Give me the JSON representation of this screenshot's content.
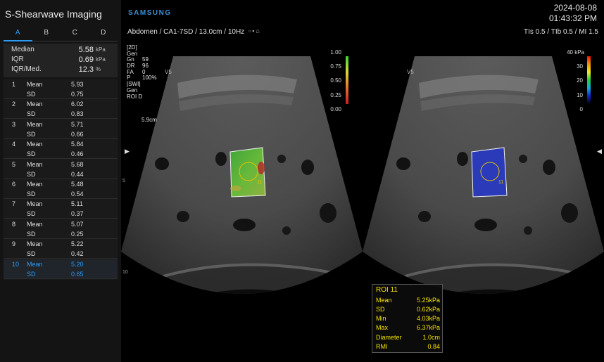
{
  "app": {
    "title": "S-Shearwave Imaging",
    "brand": "SAMSUNG",
    "date": "2024-08-08",
    "time": "01:43:32 PM"
  },
  "header": {
    "probe_line": "Abdomen / CA1-7SD / 13.0cm / 10Hz",
    "indices": "TIs  0.5 / TIb  0.5 / MI    1.5"
  },
  "tabs": [
    "A",
    "B",
    "C",
    "D"
  ],
  "active_tab": "A",
  "summary": {
    "median_label": "Median",
    "median_value": "5.58",
    "median_unit": "kPa",
    "iqr_label": "IQR",
    "iqr_value": "0.69",
    "iqr_unit": "kPa",
    "ratio_label": "IQR/Med.",
    "ratio_value": "12.3",
    "ratio_unit": "%"
  },
  "measurements": [
    {
      "index": "1",
      "mean": "5.93",
      "sd": "0.75"
    },
    {
      "index": "2",
      "mean": "6.02",
      "sd": "0.83"
    },
    {
      "index": "3",
      "mean": "5.71",
      "sd": "0.66"
    },
    {
      "index": "4",
      "mean": "5.84",
      "sd": "0.46"
    },
    {
      "index": "5",
      "mean": "5.68",
      "sd": "0.44"
    },
    {
      "index": "6",
      "mean": "5.48",
      "sd": "0.54"
    },
    {
      "index": "7",
      "mean": "5.11",
      "sd": "0.37"
    },
    {
      "index": "8",
      "mean": "5.07",
      "sd": "0.25"
    },
    {
      "index": "9",
      "mean": "5.22",
      "sd": "0.42"
    },
    {
      "index": "10",
      "mean": "5.20",
      "sd": "0.65"
    }
  ],
  "measure_labels": {
    "mean": "Mean",
    "sd": "SD"
  },
  "selected_measurement": "10",
  "params": [
    {
      "k": "[2D]",
      "v": ""
    },
    {
      "k": "Gen",
      "v": ""
    },
    {
      "k": "Gn",
      "v": "59"
    },
    {
      "k": "DR",
      "v": "96"
    },
    {
      "k": "FA",
      "v": "0"
    },
    {
      "k": "P",
      "v": "100%"
    },
    {
      "k": "[SWI]",
      "v": ""
    },
    {
      "k": "Gen",
      "v": ""
    },
    {
      "k": "ROI D",
      "v": ""
    }
  ],
  "roi_depth": "5.9cm",
  "view_label": "V5",
  "colorbar_left": {
    "labels": [
      "1.00",
      "0.75",
      "0.50",
      "0.25",
      "0.00"
    ]
  },
  "colorbar_right": {
    "labels": [
      "40 kPa",
      "30",
      "20",
      "10",
      "0"
    ]
  },
  "roi_number": "11",
  "roi_readout": {
    "title": "ROI 11",
    "rows": [
      {
        "k": "Mean",
        "v": "5.25kPa"
      },
      {
        "k": "SD",
        "v": "0.62kPa"
      },
      {
        "k": "Min",
        "v": "4.03kPa"
      },
      {
        "k": "Max",
        "v": "6.37kPa"
      },
      {
        "k": "Diameter",
        "v": "1.0cm"
      },
      {
        "k": "RMI",
        "v": "0.84"
      }
    ]
  },
  "depth_ticks": [
    "5",
    "10"
  ],
  "colors": {
    "accent": "#2a9cf5",
    "readout_text": "#f2e000",
    "roi_circle": "#e6c200",
    "brand": "#3b8fd6"
  }
}
